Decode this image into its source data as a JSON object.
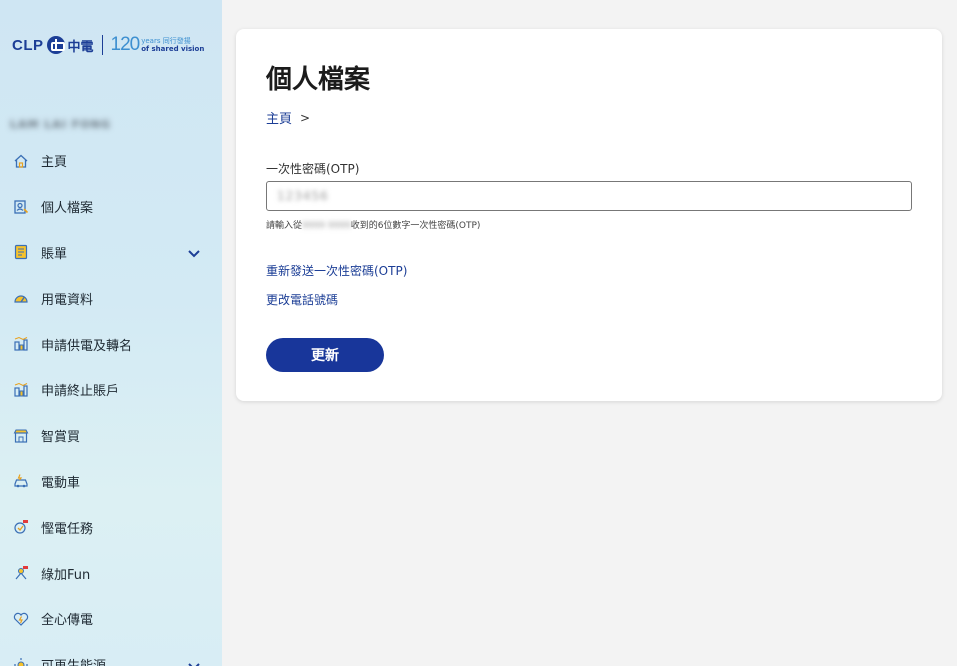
{
  "brand": {
    "clp": "CLP",
    "zh": "中電",
    "anniversary": "120",
    "years": "years 同行發揚",
    "tagline": "of shared vision"
  },
  "user": {
    "name": "LAM LAI FONG"
  },
  "sidebar": {
    "items": [
      {
        "label": "主頁",
        "icon": "home-icon"
      },
      {
        "label": "個人檔案",
        "icon": "profile-icon"
      },
      {
        "label": "賬單",
        "icon": "bill-icon",
        "expandable": true
      },
      {
        "label": "用電資料",
        "icon": "gauge-icon"
      },
      {
        "label": "申請供電及轉名",
        "icon": "building-chart-icon"
      },
      {
        "label": "申請終止賬戶",
        "icon": "building-chart-icon"
      },
      {
        "label": "智賞買",
        "icon": "shop-icon"
      },
      {
        "label": "電動車",
        "icon": "ev-icon"
      },
      {
        "label": "慳電任務",
        "icon": "mission-icon"
      },
      {
        "label": "綠加Fun",
        "icon": "green-fun-icon"
      },
      {
        "label": "全心傳電",
        "icon": "heart-icon"
      },
      {
        "label": "可再生能源",
        "icon": "renewable-icon",
        "expandable": true
      }
    ]
  },
  "main": {
    "title": "個人檔案",
    "breadcrumb": {
      "home": "主頁",
      "separator": ">"
    },
    "otp": {
      "label": "一次性密碼(OTP)",
      "value": "123456",
      "hint_prefix": "請輸入從",
      "hint_masked": "9999 9999",
      "hint_suffix": "收到的6位數字一次性密碼(OTP)"
    },
    "resend_link": "重新發送一次性密碼(OTP)",
    "change_phone_link": "更改電話號碼",
    "update_button": "更新"
  },
  "colors": {
    "brand_blue": "#1c3e96",
    "button_blue": "#18369a",
    "sidebar_bg": "#d3eaf4"
  }
}
